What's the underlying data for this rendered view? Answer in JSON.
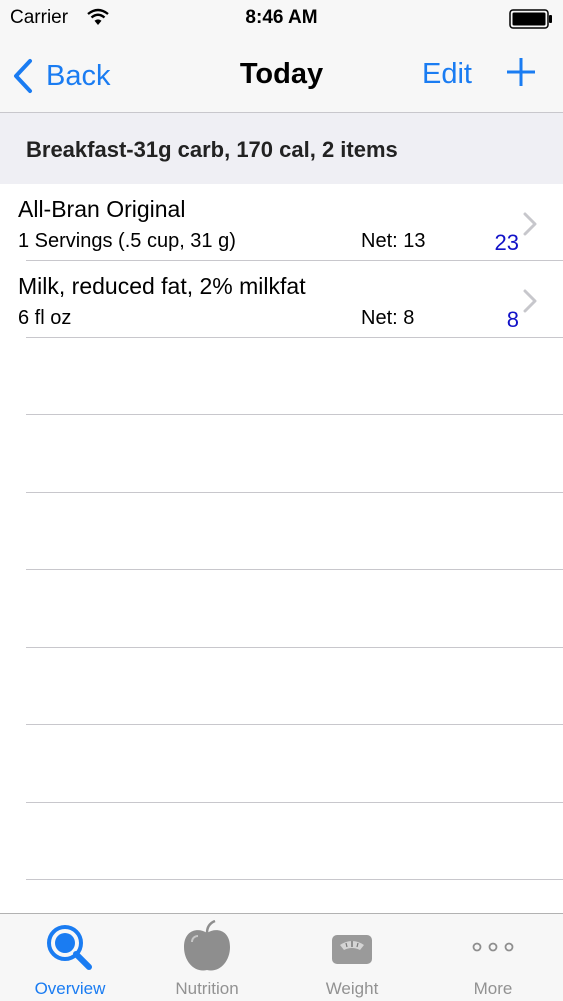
{
  "status_bar": {
    "carrier": "Carrier",
    "time": "8:46 AM"
  },
  "nav": {
    "back_label": "Back",
    "title": "Today",
    "edit_label": "Edit",
    "add_icon": "plus-icon"
  },
  "section": {
    "header": "Breakfast-31g carb, 170 cal, 2 items"
  },
  "items": [
    {
      "name": "All-Bran Original",
      "quantity": "1 Servings (.5 cup, 31 g)",
      "net": "Net: 13",
      "carbs": "23"
    },
    {
      "name": "Milk, reduced fat, 2% milkfat",
      "quantity": "6 fl oz",
      "net": "Net: 8",
      "carbs": "8"
    }
  ],
  "tabs": [
    {
      "label": "Overview",
      "icon": "magnifier-icon",
      "active": true
    },
    {
      "label": "Nutrition",
      "icon": "apple-icon",
      "active": false
    },
    {
      "label": "Weight",
      "icon": "scale-icon",
      "active": false
    },
    {
      "label": "More",
      "icon": "more-dots-icon",
      "active": false
    }
  ],
  "colors": {
    "accent": "#1a7cf2",
    "carb_value": "#1212c8",
    "inactive_tab": "#929292",
    "separator": "#c8c7cc"
  }
}
